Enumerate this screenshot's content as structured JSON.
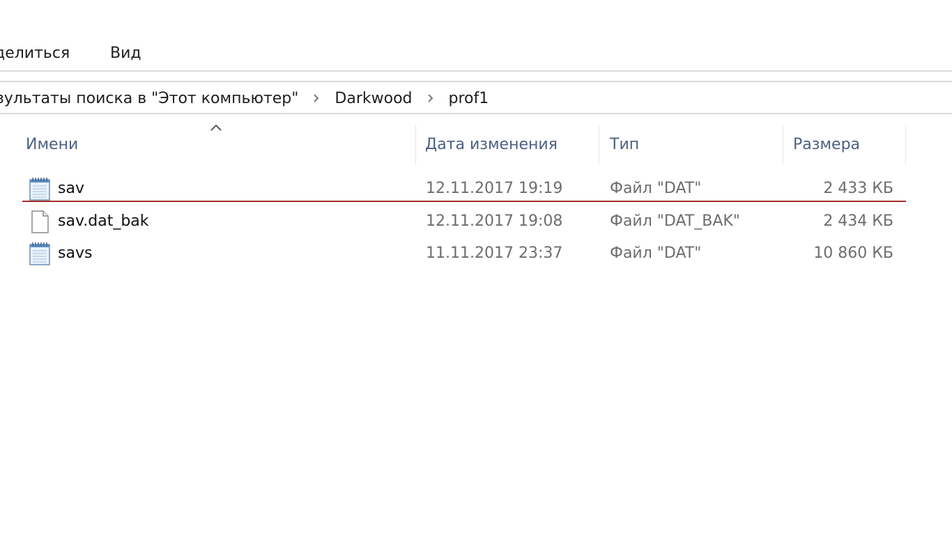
{
  "ribbon": {
    "tabs": [
      {
        "label": "делиться"
      },
      {
        "label": "Вид"
      }
    ]
  },
  "breadcrumb": {
    "items": [
      {
        "label": "зультаты поиска в \"Этот компьютер\""
      },
      {
        "label": "Darkwood"
      },
      {
        "label": "prof1"
      }
    ],
    "separator_icon": "chevron-right-icon"
  },
  "columns": {
    "name": "Имени",
    "date": "Дата изменения",
    "type": "Тип",
    "size": "Размера",
    "sort_icon": "sort-up-icon"
  },
  "files": [
    {
      "name": "sav",
      "date": "12.11.2017 19:19",
      "type": "Файл \"DAT\"",
      "size": "2 433 КБ",
      "icon": "notepad-file-icon"
    },
    {
      "name": "sav.dat_bak",
      "date": "12.11.2017 19:08",
      "type": "Файл \"DAT_BAK\"",
      "size": "2 434 КБ",
      "icon": "blank-file-icon"
    },
    {
      "name": "savs",
      "date": "11.11.2017 23:37",
      "type": "Файл \"DAT\"",
      "size": "10 860 КБ",
      "icon": "notepad-file-icon"
    }
  ],
  "colors": {
    "header_text": "#4d6082",
    "drop_indicator": "#a42a2a",
    "secondary_text": "#6d6d6d"
  }
}
